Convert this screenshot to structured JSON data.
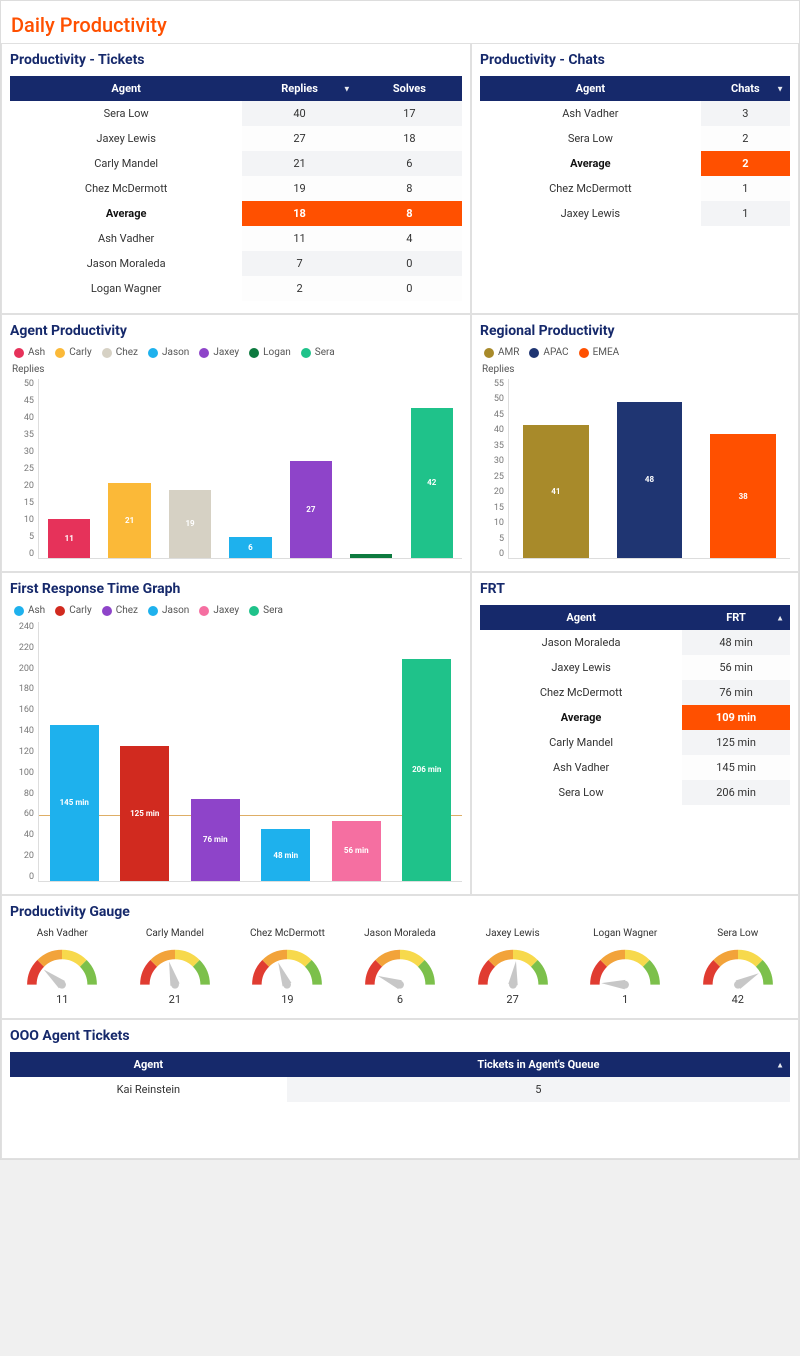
{
  "page_title": "Daily Productivity",
  "panel_titles": {
    "tickets": "Productivity - Tickets",
    "chats": "Productivity - Chats",
    "agent_prod": "Agent Productivity",
    "regional_prod": "Regional Productivity",
    "frt_graph": "First Response Time Graph",
    "frt": "FRT",
    "gauge": "Productivity Gauge",
    "ooo": "OOO Agent Tickets"
  },
  "tickets_table": {
    "headers": [
      "Agent",
      "Replies",
      "Solves"
    ],
    "sort_desc_cols": [
      1
    ],
    "rows": [
      {
        "agent": "Sera Low",
        "replies": 40,
        "solves": 17
      },
      {
        "agent": "Jaxey Lewis",
        "replies": 27,
        "solves": 18
      },
      {
        "agent": "Carly Mandel",
        "replies": 21,
        "solves": 6
      },
      {
        "agent": "Chez McDermott",
        "replies": 19,
        "solves": 8
      },
      {
        "agent": "Average",
        "replies": 18,
        "solves": 8,
        "is_average": true
      },
      {
        "agent": "Ash Vadher",
        "replies": 11,
        "solves": 4
      },
      {
        "agent": "Jason Moraleda",
        "replies": 7,
        "solves": 0
      },
      {
        "agent": "Logan Wagner",
        "replies": 2,
        "solves": 0
      }
    ]
  },
  "chats_table": {
    "headers": [
      "Agent",
      "Chats"
    ],
    "sort_desc_cols": [
      1
    ],
    "rows": [
      {
        "agent": "Ash Vadher",
        "chats": 3
      },
      {
        "agent": "Sera Low",
        "chats": 2
      },
      {
        "agent": "Average",
        "chats": 2,
        "is_average": true
      },
      {
        "agent": "Chez McDermott",
        "chats": 1
      },
      {
        "agent": "Jaxey Lewis",
        "chats": 1
      }
    ]
  },
  "frt_table": {
    "headers": [
      "Agent",
      "FRT"
    ],
    "sort_asc_cols": [
      1
    ],
    "rows": [
      {
        "agent": "Jason Moraleda",
        "frt": "48 min"
      },
      {
        "agent": "Jaxey Lewis",
        "frt": "56 min"
      },
      {
        "agent": "Chez McDermott",
        "frt": "76 min"
      },
      {
        "agent": "Average",
        "frt": "109 min",
        "is_average": true
      },
      {
        "agent": "Carly Mandel",
        "frt": "125 min"
      },
      {
        "agent": "Ash Vadher",
        "frt": "145 min"
      },
      {
        "agent": "Sera Low",
        "frt": "206 min"
      }
    ]
  },
  "ooo_table": {
    "headers": [
      "Agent",
      "Tickets in Agent's Queue"
    ],
    "sort_asc_cols": [
      1
    ],
    "rows": [
      {
        "agent": "Kai Reinstein",
        "tickets": 5
      }
    ]
  },
  "gauges": [
    {
      "name": "Ash Vadher",
      "value": 11
    },
    {
      "name": "Carly Mandel",
      "value": 21
    },
    {
      "name": "Chez McDermott",
      "value": 19
    },
    {
      "name": "Jason Moraleda",
      "value": 6
    },
    {
      "name": "Jaxey Lewis",
      "value": 27
    },
    {
      "name": "Logan Wagner",
      "value": 1
    },
    {
      "name": "Sera Low",
      "value": 42
    }
  ],
  "gauge_max": 50,
  "colors": {
    "navy": "#16296b",
    "orange": "#ff5000",
    "agents": {
      "Ash": "#e6325a",
      "Carly": "#fbb938",
      "Chez": "#d6d1c4",
      "Jason": "#1eb1ed",
      "Jaxey": "#8e44c9",
      "Logan": "#0d7a3f",
      "Sera": "#1fc28a"
    },
    "frt_agents": {
      "Ash": "#1eb1ed",
      "Carly": "#d12a1f",
      "Chez": "#8e44c9",
      "Jason": "#1eb1ed",
      "Jaxey": "#f56fa1",
      "Sera": "#1fc28a"
    },
    "regions": {
      "AMR": "#a88a2a",
      "APAC": "#1f3572",
      "EMEA": "#ff5000"
    },
    "gauge_segments": [
      "#e03c31",
      "#f2a33a",
      "#f7d94c",
      "#7cc04b"
    ]
  },
  "chart_data": [
    {
      "id": "agent_prod",
      "type": "bar",
      "title": "Agent Productivity",
      "ylabel": "Replies",
      "ylim": [
        0,
        50
      ],
      "ytick_step": 5,
      "categories": [
        "Ash",
        "Carly",
        "Chez",
        "Jason",
        "Jaxey",
        "Logan",
        "Sera"
      ],
      "values": [
        11,
        21,
        19,
        6,
        27,
        1,
        42
      ],
      "bar_labels": [
        "11",
        "21",
        "19",
        "6",
        "27",
        "",
        "42"
      ],
      "color_key": "agents"
    },
    {
      "id": "regional_prod",
      "type": "bar",
      "title": "Regional Productivity",
      "ylabel": "Replies",
      "ylim": [
        0,
        55
      ],
      "ytick_step": 5,
      "categories": [
        "AMR",
        "APAC",
        "EMEA"
      ],
      "values": [
        41,
        48,
        38
      ],
      "bar_labels": [
        "41",
        "48",
        "38"
      ],
      "color_key": "regions"
    },
    {
      "id": "frt_graph",
      "type": "bar",
      "title": "First Response Time Graph",
      "ylabel": "",
      "ylim": [
        0,
        240
      ],
      "ytick_step": 20,
      "categories": [
        "Ash",
        "Carly",
        "Chez",
        "Jason",
        "Jaxey",
        "Sera"
      ],
      "values": [
        145,
        125,
        76,
        48,
        56,
        206
      ],
      "bar_labels": [
        "145 min",
        "125 min",
        "76 min",
        "48 min",
        "56 min",
        "206 min"
      ],
      "color_key": "frt_agents",
      "reference_line": 60
    }
  ]
}
